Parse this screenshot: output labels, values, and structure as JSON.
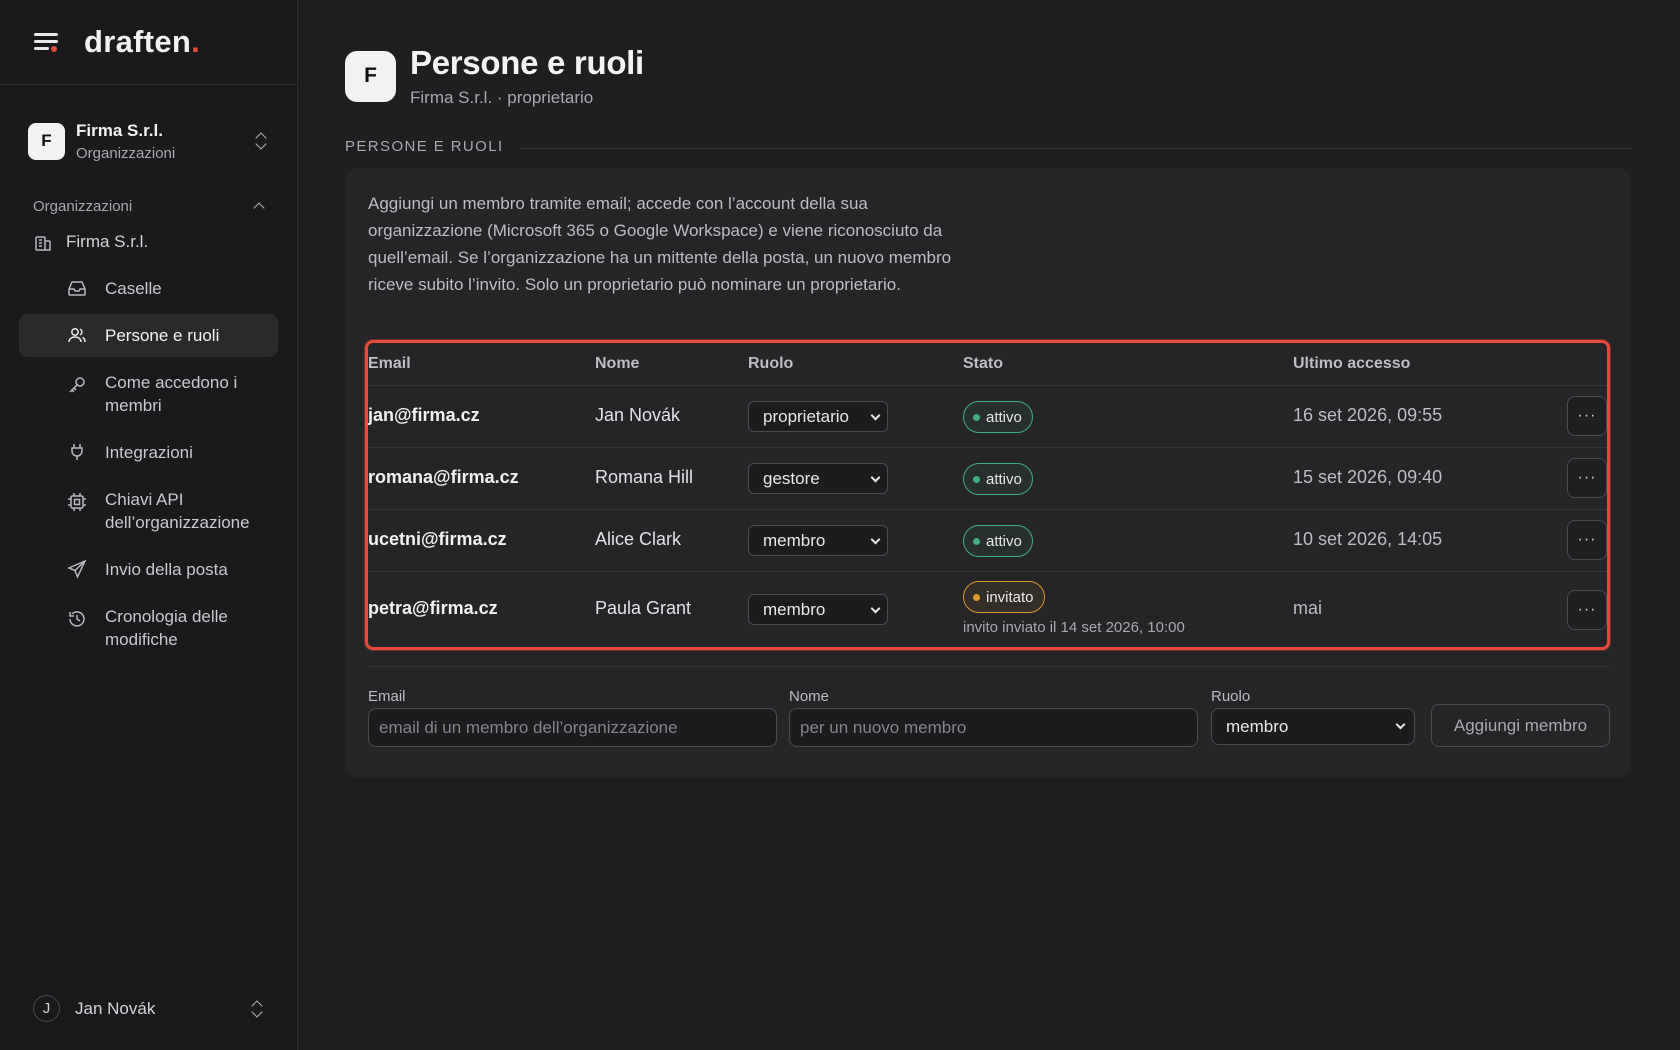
{
  "app": {
    "logo_text": "draften",
    "logo_dot": "."
  },
  "org_switcher": {
    "initial": "F",
    "name": "Firma S.r.l.",
    "subtitle": "Organizzazioni"
  },
  "nav": {
    "section_label": "Organizzazioni",
    "org_label": "Firma S.r.l.",
    "items": [
      {
        "label": "Caselle",
        "icon": "inbox-icon"
      },
      {
        "label": "Persone e ruoli",
        "icon": "users-icon"
      },
      {
        "label": "Come accedono i membri",
        "icon": "key-icon"
      },
      {
        "label": "Integrazioni",
        "icon": "plug-icon"
      },
      {
        "label": "Chiavi API dell’organizzazione",
        "icon": "chip-icon"
      },
      {
        "label": "Invio della posta",
        "icon": "send-icon"
      },
      {
        "label": "Cronologia delle modifiche",
        "icon": "history-icon"
      }
    ]
  },
  "user": {
    "initial": "J",
    "name": "Jan Novák"
  },
  "header": {
    "initial": "F",
    "title": "Persone e ruoli",
    "subtitle": "Firma S.r.l. · proprietario"
  },
  "section": {
    "label": "PERSONE E RUOLI"
  },
  "intro": "Aggiungi un membro tramite email; accede con l’account della sua organizzazione (Microsoft 365 o Google Workspace) e viene riconosciuto da quell’email. Se l’organizzazione ha un mittente della posta, un nuovo membro riceve subito l’invito. Solo un proprietario può nominare un proprietario.",
  "table": {
    "columns": {
      "email": "Email",
      "name": "Nome",
      "role": "Ruolo",
      "status": "Stato",
      "last_access": "Ultimo accesso"
    },
    "rows": [
      {
        "email": "jan@firma.cz",
        "name": "Jan Novák",
        "role": "proprietario",
        "status": "attivo",
        "status_kind": "active",
        "last_access": "16 set 2026, 09:55",
        "note": ""
      },
      {
        "email": "romana@firma.cz",
        "name": "Romana Hill",
        "role": "gestore",
        "status": "attivo",
        "status_kind": "active",
        "last_access": "15 set 2026, 09:40",
        "note": ""
      },
      {
        "email": "ucetni@firma.cz",
        "name": "Alice Clark",
        "role": "membro",
        "status": "attivo",
        "status_kind": "active",
        "last_access": "10 set 2026, 14:05",
        "note": ""
      },
      {
        "email": "petra@firma.cz",
        "name": "Paula Grant",
        "role": "membro",
        "status": "invitato",
        "status_kind": "invited",
        "last_access": "mai",
        "note": "invito inviato il 14 set 2026, 10:00"
      }
    ],
    "more_label": "···"
  },
  "form": {
    "email_label": "Email",
    "email_placeholder": "email di un membro dell’organizzazione",
    "name_label": "Nome",
    "name_placeholder": "per un nuovo membro",
    "role_label": "Ruolo",
    "role_value": "membro",
    "submit_label": "Aggiungi membro"
  },
  "colors": {
    "accent": "#e84a3a",
    "active": "#3fae7e",
    "invited": "#d99a2b"
  }
}
